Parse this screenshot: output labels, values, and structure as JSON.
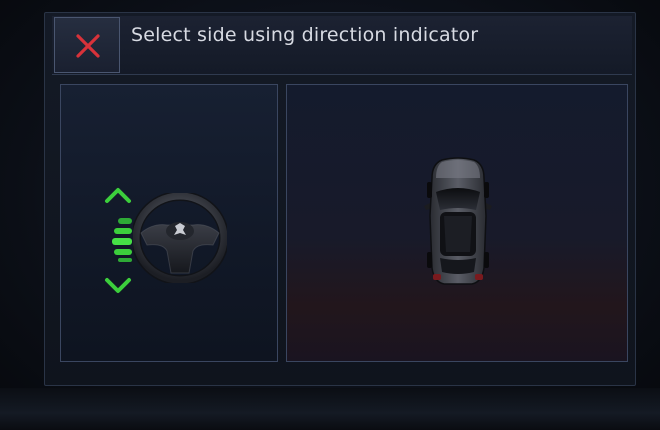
{
  "header": {
    "title": "Select side using direction indicator"
  },
  "icons": {
    "close": "close-icon",
    "up": "chevron-up-icon",
    "down": "chevron-down-icon",
    "steering": "steering-wheel-icon",
    "car": "car-top-view-icon"
  },
  "colors": {
    "close_x": "#d8323a",
    "indicator_green": "#3ccf3c",
    "text": "#d7dae2"
  }
}
